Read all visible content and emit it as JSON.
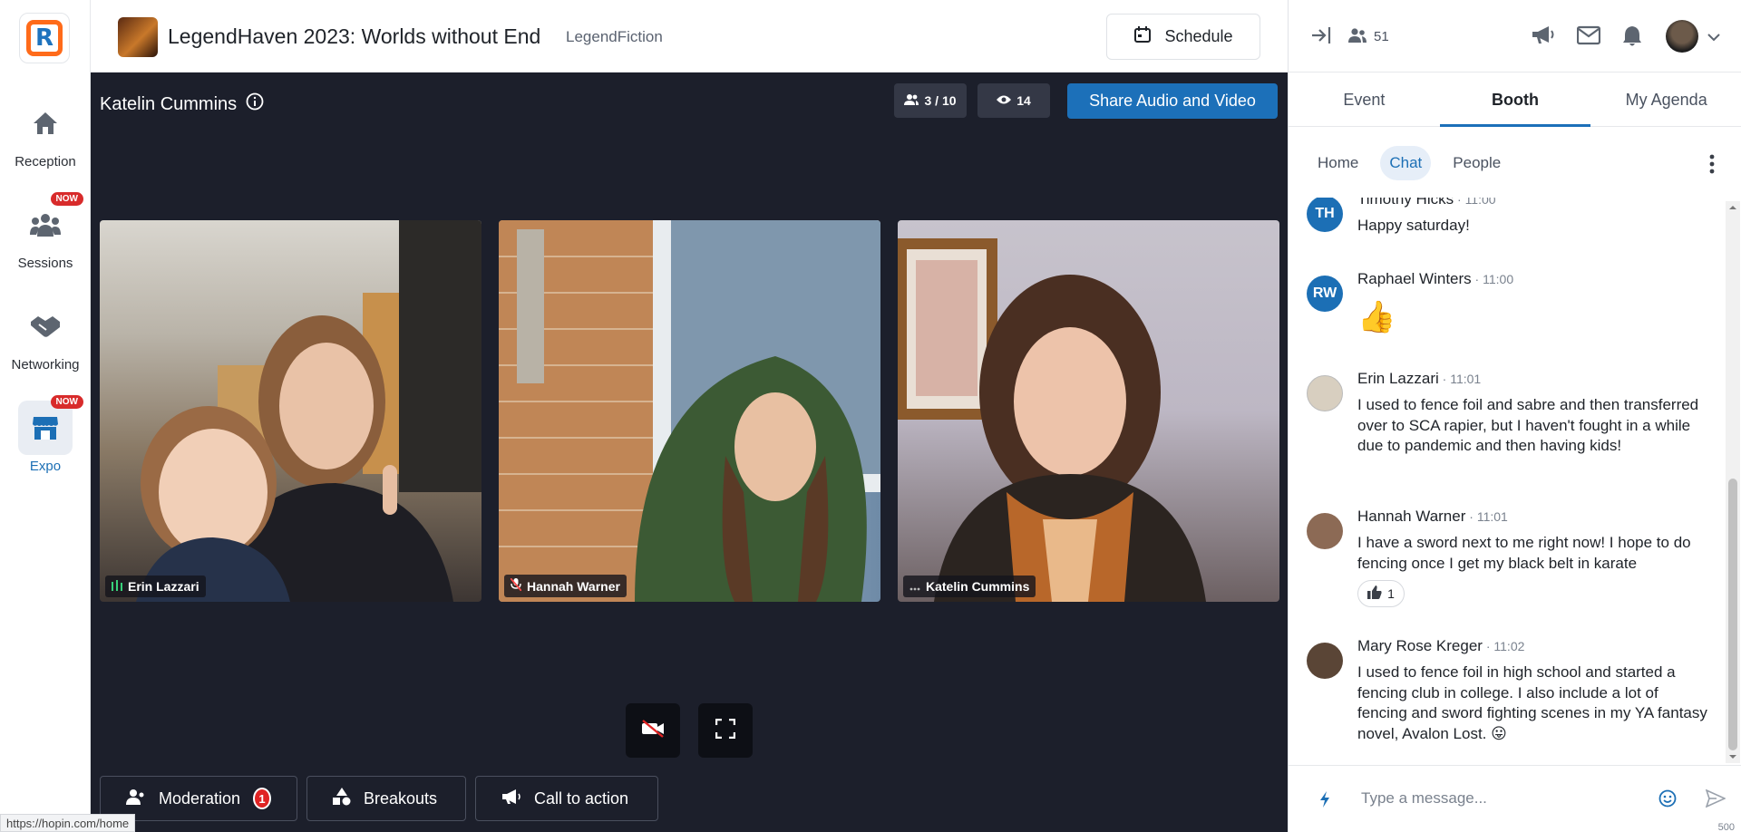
{
  "nav": {
    "items": [
      {
        "label": "Reception",
        "icon": "home-icon"
      },
      {
        "label": "Sessions",
        "icon": "sessions-icon",
        "badge": "NOW"
      },
      {
        "label": "Networking",
        "icon": "handshake-icon"
      },
      {
        "label": "Expo",
        "icon": "booth-icon",
        "badge": "NOW",
        "active": true
      }
    ]
  },
  "header": {
    "event_title": "LegendHaven 2023: Worlds without End",
    "org_name": "LegendFiction",
    "schedule_label": "Schedule"
  },
  "stage": {
    "host_name": "Katelin Cummins",
    "participants_count": "3 / 10",
    "viewers_count": "14",
    "share_label": "Share Audio and Video",
    "tiles": [
      {
        "name": "Erin Lazzari",
        "status": "speaking"
      },
      {
        "name": "Hannah Warner",
        "status": "muted"
      },
      {
        "name": "Katelin Cummins",
        "status": "more"
      }
    ],
    "bottom": {
      "moderation_label": "Moderation",
      "moderation_count": "1",
      "breakouts_label": "Breakouts",
      "cta_label": "Call to action"
    }
  },
  "status_url": "https://hopin.com/home",
  "panel": {
    "attendee_count": "51",
    "tabs": [
      "Event",
      "Booth",
      "My Agenda"
    ],
    "active_tab": "Booth",
    "subtabs": [
      "Home",
      "Chat",
      "People"
    ],
    "active_subtab": "Chat",
    "messages": [
      {
        "initials": "TH",
        "author": "Timothy Hicks",
        "time": "11:00",
        "text": "Happy saturday!",
        "avatar_color": "#1c6fb5"
      },
      {
        "initials": "RW",
        "author": "Raphael Winters",
        "time": "11:00",
        "text": "👍",
        "avatar_color": "#1c6fb5"
      },
      {
        "initials": "",
        "author": "Erin Lazzari",
        "time": "11:01",
        "text": "I used to fence foil and sabre and then transferred over to SCA rapier, but I haven't fought in a while due to pandemic and then having kids!",
        "avatar_color": "#d8cfc0"
      },
      {
        "initials": "",
        "author": "Hannah Warner",
        "time": "11:01",
        "text": "I have a sword next to me right now! I hope to do fencing once I get my black belt in karate",
        "avatar_color": "#8c6a55",
        "reaction_count": "1"
      },
      {
        "initials": "",
        "author": "Mary Rose Kreger",
        "time": "11:02",
        "text": "I used to fence foil in high school and started a fencing club in college. I also include a lot of fencing and sword fighting scenes in my YA fantasy novel, Avalon Lost. 😛",
        "avatar_color": "#5a4536"
      }
    ],
    "composer": {
      "placeholder": "Type a message...",
      "char_limit": "500"
    }
  },
  "colors": {
    "brand_blue": "#1c70b9",
    "stage_bg": "#1c1f2b",
    "alert_red": "#e02323",
    "logo_orange": "#ff6b1a"
  }
}
